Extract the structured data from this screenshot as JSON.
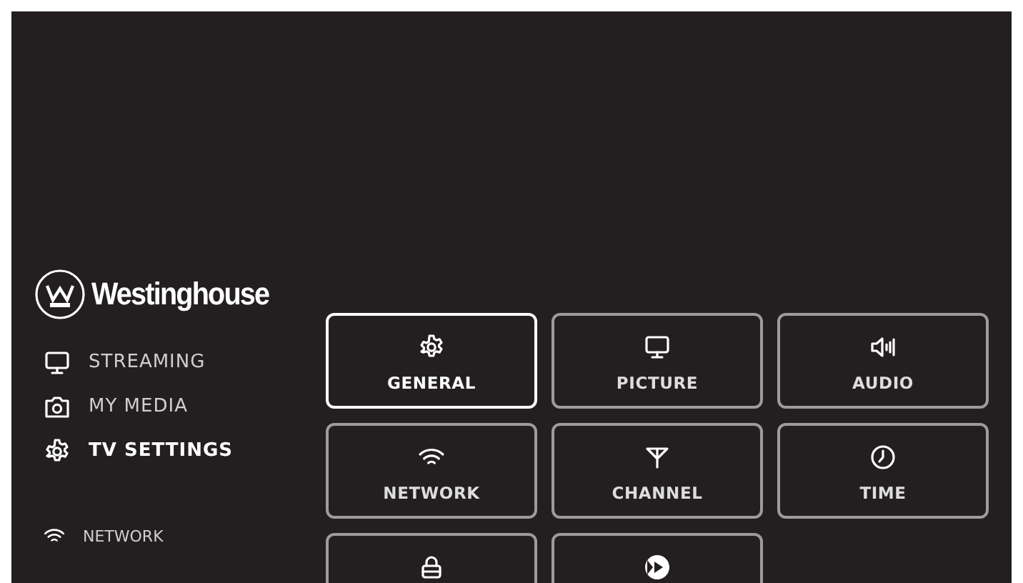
{
  "logo": {
    "text": "Westinghouse"
  },
  "sidebar": {
    "items": [
      {
        "label": "STREAMING",
        "selected": false
      },
      {
        "label": "MY MEDIA",
        "selected": false
      },
      {
        "label": "TV SETTINGS",
        "selected": true
      }
    ],
    "status": {
      "label": "NETWORK"
    }
  },
  "tiles": [
    {
      "label": "GENERAL",
      "selected": true
    },
    {
      "label": "PICTURE",
      "selected": false
    },
    {
      "label": "AUDIO",
      "selected": false
    },
    {
      "label": "NETWORK",
      "selected": false
    },
    {
      "label": "CHANNEL",
      "selected": false
    },
    {
      "label": "TIME",
      "selected": false
    },
    {
      "selected": false
    },
    {
      "selected": false
    }
  ]
}
